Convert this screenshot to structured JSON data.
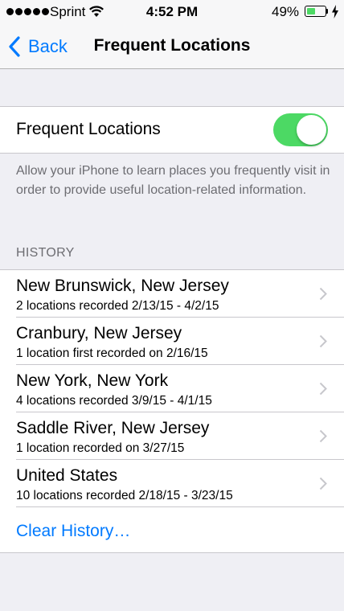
{
  "status_bar": {
    "carrier": "Sprint",
    "time": "4:52 PM",
    "battery_percent": "49%",
    "battery_level": 0.49,
    "signal_dots": 5
  },
  "nav": {
    "back_label": "Back",
    "title": "Frequent Locations"
  },
  "toggle": {
    "label": "Frequent Locations",
    "on": true
  },
  "description": "Allow your iPhone to learn places you frequently visit in order to provide useful location-related information.",
  "history": {
    "header": "HISTORY",
    "items": [
      {
        "title": "New Brunswick, New Jersey",
        "subtitle": "2 locations recorded 2/13/15 - 4/2/15"
      },
      {
        "title": "Cranbury, New Jersey",
        "subtitle": "1 location first recorded on 2/16/15"
      },
      {
        "title": "New York, New York",
        "subtitle": "4 locations recorded 3/9/15 - 4/1/15"
      },
      {
        "title": "Saddle River, New Jersey",
        "subtitle": "1 location recorded on 3/27/15"
      },
      {
        "title": "United States",
        "subtitle": "10 locations recorded 2/18/15 - 3/23/15"
      }
    ],
    "clear_label": "Clear History…"
  },
  "colors": {
    "accent": "#007aff",
    "switch_on": "#4cd964",
    "background": "#efeff4"
  }
}
